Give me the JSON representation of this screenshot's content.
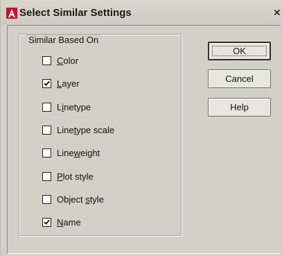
{
  "dialog": {
    "title": "Select Similar Settings",
    "close_glyph": "✕",
    "icon": "autocad-a-icon",
    "accent_color": "#c8102e"
  },
  "group": {
    "legend": "Similar Based On",
    "items": [
      {
        "pre": "",
        "key": "C",
        "post": "olor",
        "checked": false
      },
      {
        "pre": "",
        "key": "L",
        "post": "ayer",
        "checked": true
      },
      {
        "pre": "L",
        "key": "i",
        "post": "netype",
        "checked": false
      },
      {
        "pre": "Line",
        "key": "t",
        "post": "ype scale",
        "checked": false
      },
      {
        "pre": "Line",
        "key": "w",
        "post": "eight",
        "checked": false
      },
      {
        "pre": "",
        "key": "P",
        "post": "lot style",
        "checked": false
      },
      {
        "pre": "Object ",
        "key": "s",
        "post": "tyle",
        "checked": false
      },
      {
        "pre": "",
        "key": "N",
        "post": "ame",
        "checked": true
      }
    ]
  },
  "buttons": {
    "ok": "OK",
    "cancel": "Cancel",
    "help": "Help"
  }
}
